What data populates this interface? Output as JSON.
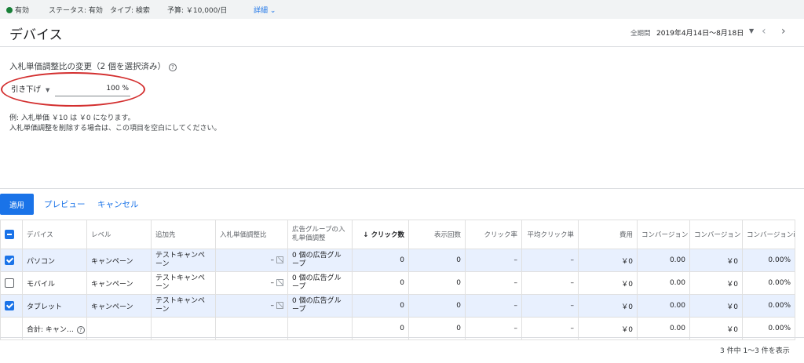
{
  "topbar": {
    "status": "有効",
    "status_detail": "ステータス: 有効",
    "type": "タイプ: 検索",
    "budget": "予算: ￥10,000/日",
    "details_link": "詳細"
  },
  "header": {
    "title": "デバイス",
    "range_label": "全期間",
    "range_value": "2019年4月14日～8月18日"
  },
  "panel": {
    "title": "入札単価調整比の変更（2 個を選択済み）",
    "bid_mode": "引き下げ",
    "bid_value": "100 %",
    "hint_line1": "例: 入札単価 ￥10 は ￥0 になります。",
    "hint_line2": "入札単価調整を削除する場合は、この項目を空白にしてください。"
  },
  "actions": {
    "apply": "適用",
    "preview": "プレビュー",
    "cancel": "キャンセル"
  },
  "table": {
    "headers": {
      "device": "デバイス",
      "level": "レベル",
      "added_to": "追加先",
      "bid_adj": "入札単価調整比",
      "adgroup_bid_adj": "広告グループの入札単価調整",
      "clicks": "クリック数",
      "impressions": "表示回数",
      "ctr": "クリック率",
      "avg_cpc": "平均クリック単",
      "cost": "費用",
      "conversions": "コンバージョン",
      "conv_cost": "コンバージョン",
      "conv_rate": "コンバージョンi"
    },
    "rows": [
      {
        "device": "パソコン",
        "level": "キャンペーン",
        "added_to": "テストキャンペーン",
        "bid_adj": "–",
        "adgroup": "0 個の広告グループ",
        "clicks": "0",
        "impressions": "0",
        "ctr": "–",
        "avg_cpc": "–",
        "cost": "￥0",
        "conversions": "0.00",
        "conv_cost": "￥0",
        "conv_rate": "0.00%"
      },
      {
        "device": "モバイル",
        "level": "キャンペーン",
        "added_to": "テストキャンペーン",
        "bid_adj": "–",
        "adgroup": "0 個の広告グループ",
        "clicks": "0",
        "impressions": "0",
        "ctr": "–",
        "avg_cpc": "–",
        "cost": "￥0",
        "conversions": "0.00",
        "conv_cost": "￥0",
        "conv_rate": "0.00%"
      },
      {
        "device": "タブレット",
        "level": "キャンペーン",
        "added_to": "テストキャンペーン",
        "bid_adj": "–",
        "adgroup": "0 個の広告グループ",
        "clicks": "0",
        "impressions": "0",
        "ctr": "–",
        "avg_cpc": "–",
        "cost": "￥0",
        "conversions": "0.00",
        "conv_cost": "￥0",
        "conv_rate": "0.00%"
      }
    ],
    "total": {
      "label": "合計: キャン…",
      "clicks": "0",
      "impressions": "0",
      "ctr": "–",
      "avg_cpc": "–",
      "cost": "￥0",
      "conversions": "0.00",
      "conv_cost": "￥0",
      "conv_rate": "0.00%"
    }
  },
  "footer": {
    "count": "3 件中 1～3 件を表示"
  },
  "colors": {
    "accent": "#1a73e8",
    "status_green": "#188038",
    "highlight_red": "#d32f2f",
    "selected_row": "#e8f0fe"
  }
}
